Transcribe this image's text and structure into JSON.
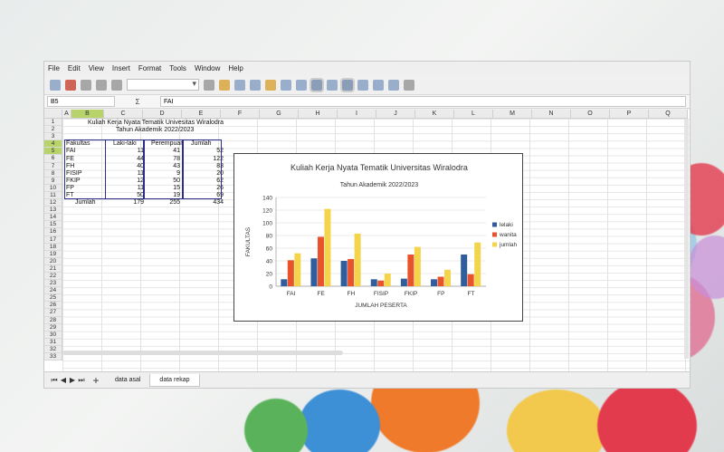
{
  "menu": [
    "File",
    "Edit",
    "View",
    "Insert",
    "Format",
    "Tools",
    "Window",
    "Help"
  ],
  "formula": {
    "cell_ref": "B5",
    "fx_label": "Σ",
    "content": "FAI"
  },
  "columns": [
    "A",
    "B",
    "C",
    "D",
    "E",
    "F",
    "G",
    "H",
    "I",
    "J",
    "K",
    "L",
    "M",
    "N",
    "O",
    "P",
    "Q"
  ],
  "rows": [
    "1",
    "2",
    "3",
    "4",
    "5",
    "6",
    "7",
    "8",
    "9",
    "10",
    "11",
    "12",
    "13",
    "14",
    "15",
    "16",
    "17",
    "18",
    "19",
    "20",
    "21",
    "22",
    "23",
    "24",
    "25",
    "26",
    "27",
    "28",
    "29",
    "30",
    "31",
    "32",
    "33"
  ],
  "sheet": {
    "title1": "Kuliah Kerja Nyata Tematik Univesitas Wiralodra",
    "title2": "Tahun Akademik 2022/2023",
    "headers": [
      "Fakultas",
      "Laki-laki",
      "Perempuan",
      "Jumlah"
    ],
    "table": [
      {
        "fak": "FAI",
        "l": "11",
        "p": "41",
        "j": "52"
      },
      {
        "fak": "FE",
        "l": "44",
        "p": "78",
        "j": "122"
      },
      {
        "fak": "FH",
        "l": "40",
        "p": "43",
        "j": "83"
      },
      {
        "fak": "FISIP",
        "l": "11",
        "p": "9",
        "j": "20"
      },
      {
        "fak": "FKIP",
        "l": "12",
        "p": "50",
        "j": "62"
      },
      {
        "fak": "FP",
        "l": "11",
        "p": "15",
        "j": "26"
      },
      {
        "fak": "FT",
        "l": "50",
        "p": "19",
        "j": "69"
      }
    ],
    "total": {
      "label": "Jumlah",
      "l": "179",
      "p": "255",
      "j": "434"
    }
  },
  "tabs": [
    "data asal",
    "data rekap"
  ],
  "chart_data": {
    "type": "bar",
    "title": "Kuliah Kerja Nyata Tematik Universitas Wiralodra",
    "subtitle": "Tahun Akademik 2022/2023",
    "xlabel": "JUMLAH PESERTA",
    "ylabel": "FAKULTAS",
    "categories": [
      "FAI",
      "FE",
      "FH",
      "FISIP",
      "FKIP",
      "FP",
      "FT"
    ],
    "ylim": [
      0,
      140
    ],
    "yticks": [
      0,
      20,
      40,
      60,
      80,
      100,
      120,
      140
    ],
    "legend": "right",
    "grid": true,
    "series": [
      {
        "name": "lelaki",
        "color": "#2f5d9e",
        "values": [
          11,
          44,
          40,
          11,
          12,
          11,
          50
        ]
      },
      {
        "name": "wanita",
        "color": "#e8532b",
        "values": [
          41,
          78,
          43,
          9,
          50,
          15,
          19
        ]
      },
      {
        "name": "jumlah",
        "color": "#f4d44b",
        "values": [
          52,
          122,
          83,
          20,
          62,
          26,
          69
        ]
      }
    ]
  }
}
